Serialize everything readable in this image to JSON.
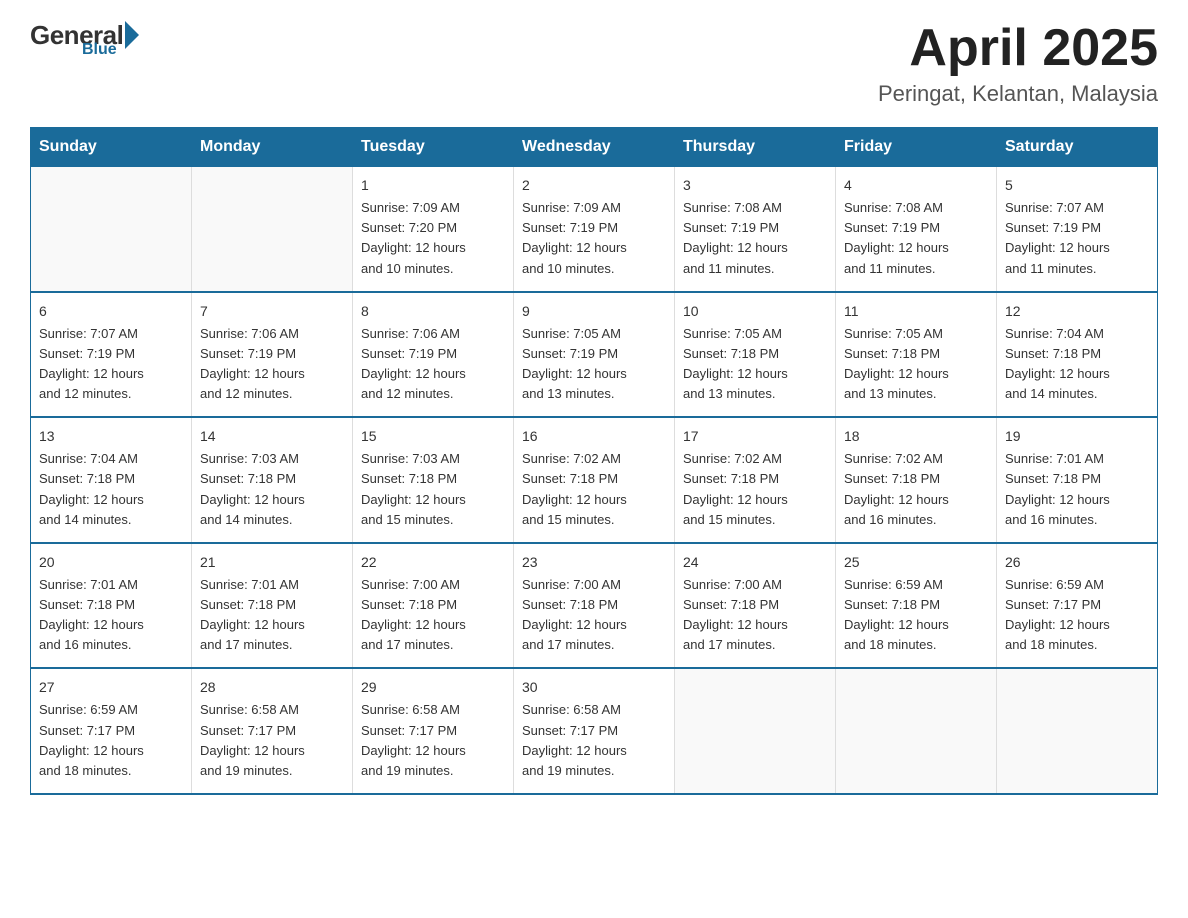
{
  "header": {
    "logo": {
      "general": "General",
      "blue": "Blue",
      "subtitle": "Blue"
    },
    "title": "April 2025",
    "subtitle": "Peringat, Kelantan, Malaysia"
  },
  "weekdays": [
    "Sunday",
    "Monday",
    "Tuesday",
    "Wednesday",
    "Thursday",
    "Friday",
    "Saturday"
  ],
  "weeks": [
    [
      {
        "day": "",
        "info": ""
      },
      {
        "day": "",
        "info": ""
      },
      {
        "day": "1",
        "info": "Sunrise: 7:09 AM\nSunset: 7:20 PM\nDaylight: 12 hours\nand 10 minutes."
      },
      {
        "day": "2",
        "info": "Sunrise: 7:09 AM\nSunset: 7:19 PM\nDaylight: 12 hours\nand 10 minutes."
      },
      {
        "day": "3",
        "info": "Sunrise: 7:08 AM\nSunset: 7:19 PM\nDaylight: 12 hours\nand 11 minutes."
      },
      {
        "day": "4",
        "info": "Sunrise: 7:08 AM\nSunset: 7:19 PM\nDaylight: 12 hours\nand 11 minutes."
      },
      {
        "day": "5",
        "info": "Sunrise: 7:07 AM\nSunset: 7:19 PM\nDaylight: 12 hours\nand 11 minutes."
      }
    ],
    [
      {
        "day": "6",
        "info": "Sunrise: 7:07 AM\nSunset: 7:19 PM\nDaylight: 12 hours\nand 12 minutes."
      },
      {
        "day": "7",
        "info": "Sunrise: 7:06 AM\nSunset: 7:19 PM\nDaylight: 12 hours\nand 12 minutes."
      },
      {
        "day": "8",
        "info": "Sunrise: 7:06 AM\nSunset: 7:19 PM\nDaylight: 12 hours\nand 12 minutes."
      },
      {
        "day": "9",
        "info": "Sunrise: 7:05 AM\nSunset: 7:19 PM\nDaylight: 12 hours\nand 13 minutes."
      },
      {
        "day": "10",
        "info": "Sunrise: 7:05 AM\nSunset: 7:18 PM\nDaylight: 12 hours\nand 13 minutes."
      },
      {
        "day": "11",
        "info": "Sunrise: 7:05 AM\nSunset: 7:18 PM\nDaylight: 12 hours\nand 13 minutes."
      },
      {
        "day": "12",
        "info": "Sunrise: 7:04 AM\nSunset: 7:18 PM\nDaylight: 12 hours\nand 14 minutes."
      }
    ],
    [
      {
        "day": "13",
        "info": "Sunrise: 7:04 AM\nSunset: 7:18 PM\nDaylight: 12 hours\nand 14 minutes."
      },
      {
        "day": "14",
        "info": "Sunrise: 7:03 AM\nSunset: 7:18 PM\nDaylight: 12 hours\nand 14 minutes."
      },
      {
        "day": "15",
        "info": "Sunrise: 7:03 AM\nSunset: 7:18 PM\nDaylight: 12 hours\nand 15 minutes."
      },
      {
        "day": "16",
        "info": "Sunrise: 7:02 AM\nSunset: 7:18 PM\nDaylight: 12 hours\nand 15 minutes."
      },
      {
        "day": "17",
        "info": "Sunrise: 7:02 AM\nSunset: 7:18 PM\nDaylight: 12 hours\nand 15 minutes."
      },
      {
        "day": "18",
        "info": "Sunrise: 7:02 AM\nSunset: 7:18 PM\nDaylight: 12 hours\nand 16 minutes."
      },
      {
        "day": "19",
        "info": "Sunrise: 7:01 AM\nSunset: 7:18 PM\nDaylight: 12 hours\nand 16 minutes."
      }
    ],
    [
      {
        "day": "20",
        "info": "Sunrise: 7:01 AM\nSunset: 7:18 PM\nDaylight: 12 hours\nand 16 minutes."
      },
      {
        "day": "21",
        "info": "Sunrise: 7:01 AM\nSunset: 7:18 PM\nDaylight: 12 hours\nand 17 minutes."
      },
      {
        "day": "22",
        "info": "Sunrise: 7:00 AM\nSunset: 7:18 PM\nDaylight: 12 hours\nand 17 minutes."
      },
      {
        "day": "23",
        "info": "Sunrise: 7:00 AM\nSunset: 7:18 PM\nDaylight: 12 hours\nand 17 minutes."
      },
      {
        "day": "24",
        "info": "Sunrise: 7:00 AM\nSunset: 7:18 PM\nDaylight: 12 hours\nand 17 minutes."
      },
      {
        "day": "25",
        "info": "Sunrise: 6:59 AM\nSunset: 7:18 PM\nDaylight: 12 hours\nand 18 minutes."
      },
      {
        "day": "26",
        "info": "Sunrise: 6:59 AM\nSunset: 7:17 PM\nDaylight: 12 hours\nand 18 minutes."
      }
    ],
    [
      {
        "day": "27",
        "info": "Sunrise: 6:59 AM\nSunset: 7:17 PM\nDaylight: 12 hours\nand 18 minutes."
      },
      {
        "day": "28",
        "info": "Sunrise: 6:58 AM\nSunset: 7:17 PM\nDaylight: 12 hours\nand 19 minutes."
      },
      {
        "day": "29",
        "info": "Sunrise: 6:58 AM\nSunset: 7:17 PM\nDaylight: 12 hours\nand 19 minutes."
      },
      {
        "day": "30",
        "info": "Sunrise: 6:58 AM\nSunset: 7:17 PM\nDaylight: 12 hours\nand 19 minutes."
      },
      {
        "day": "",
        "info": ""
      },
      {
        "day": "",
        "info": ""
      },
      {
        "day": "",
        "info": ""
      }
    ]
  ]
}
